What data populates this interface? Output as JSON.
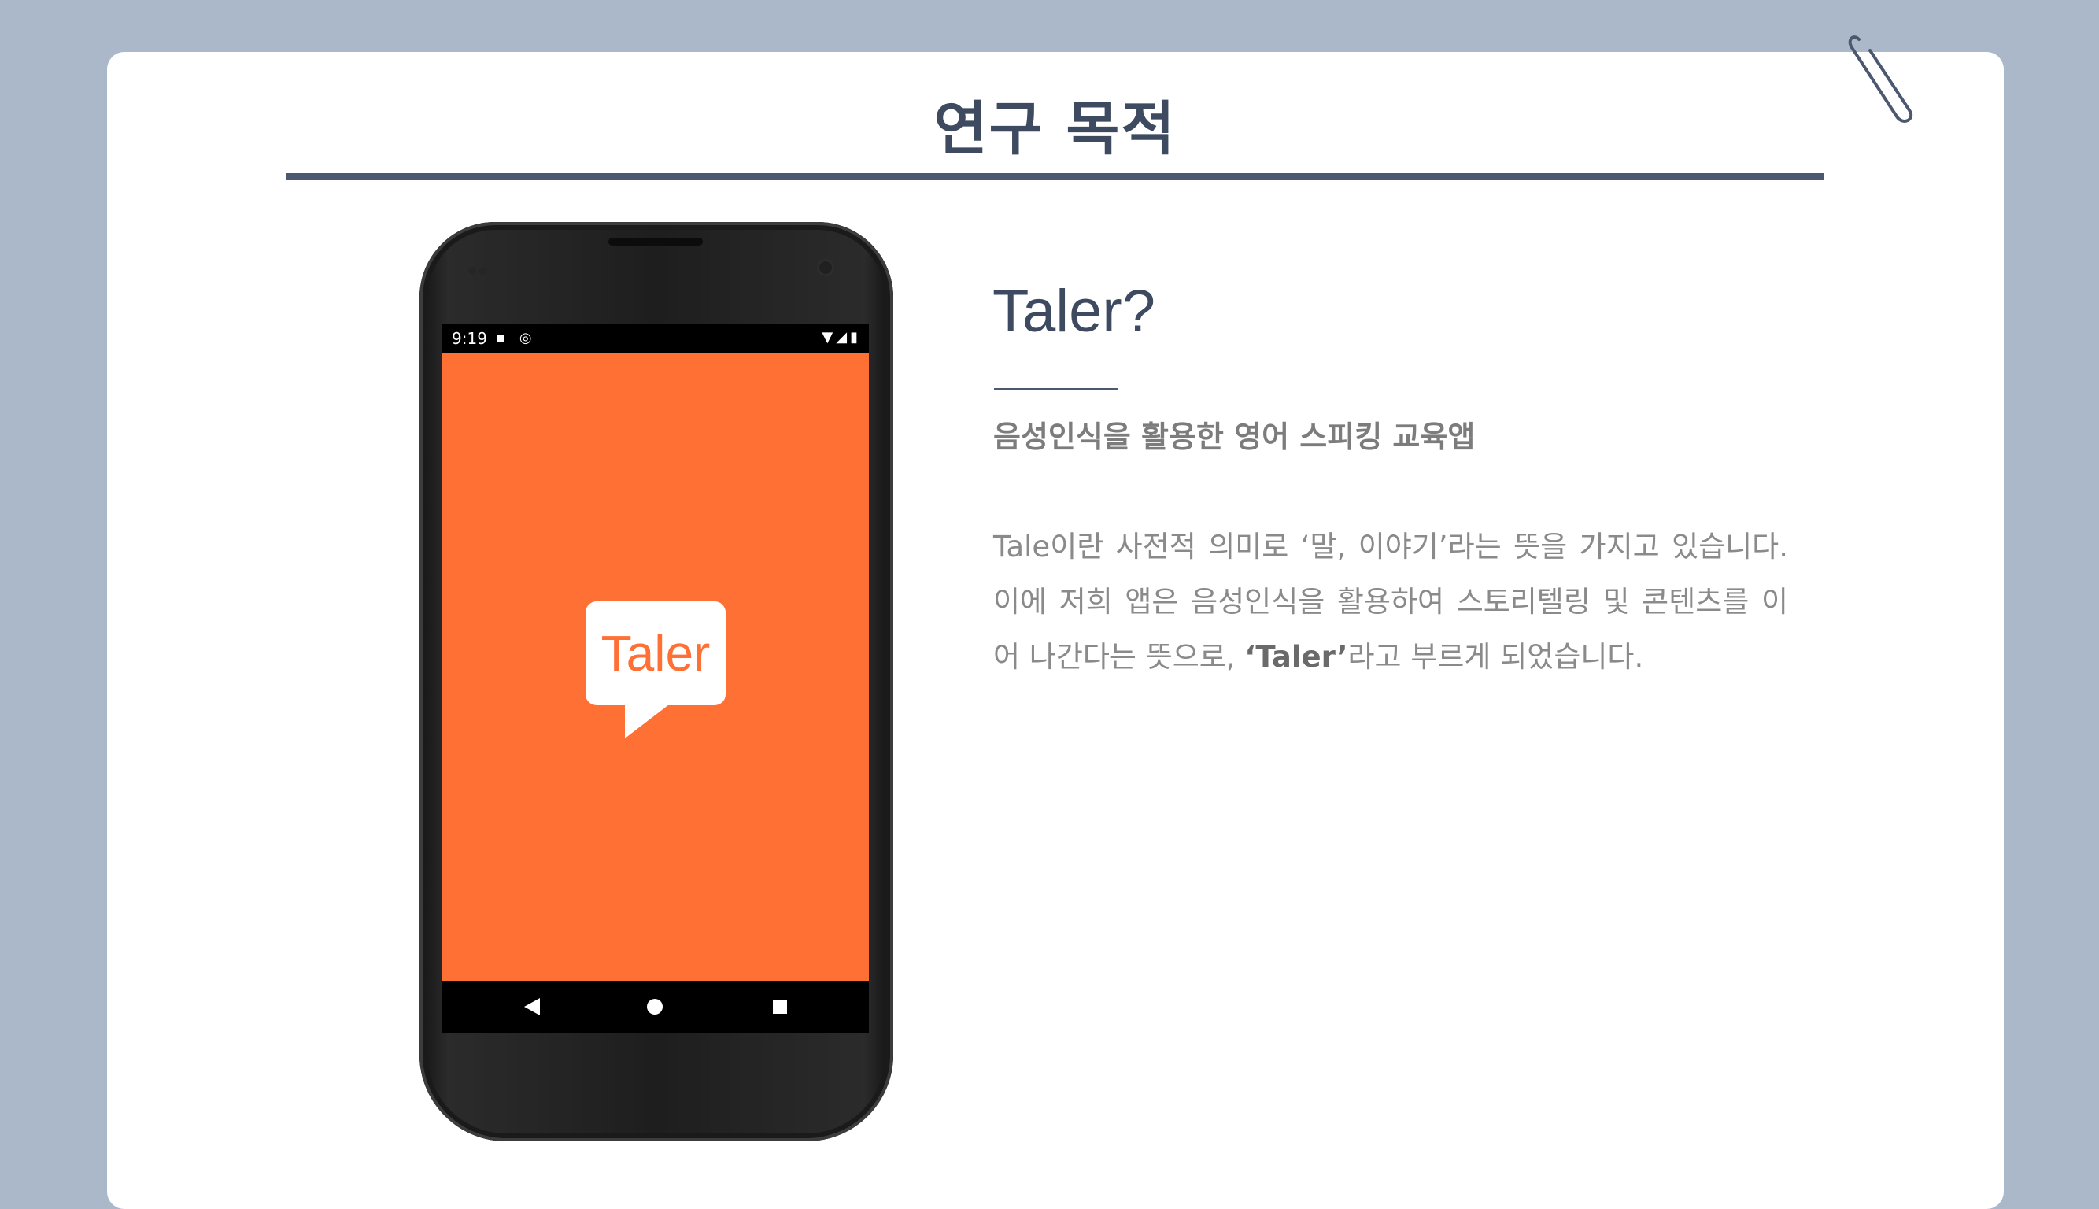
{
  "slide": {
    "title": "연구 목적"
  },
  "phone": {
    "status_time": "9:19",
    "status_left_icons": "▪ ◎",
    "status_right_icons": "▼◢▮",
    "app_logo_text": "Taler",
    "colors": {
      "screen": "#ff7035",
      "bezel": "#1e1e1e"
    }
  },
  "content": {
    "heading": "Taler?",
    "subheading": "음성인식을 활용한 영어 스피킹 교육앱",
    "paragraph": {
      "part1": "Tale이란 사전적 의미로 ‘말, 이야기’라는 뜻을 가지고 있습니다. 이에 저희 앱은 음성인식을 활용하여 스토리텔링 및 콘텐츠를 이어 나간다는 뜻으로, ",
      "emphasis": "‘Taler’",
      "part2": "라고 부르게 되었습니다."
    }
  },
  "colors": {
    "background": "#aab8ca",
    "title": "#3d4a60",
    "body_text": "#8a8a8a"
  }
}
